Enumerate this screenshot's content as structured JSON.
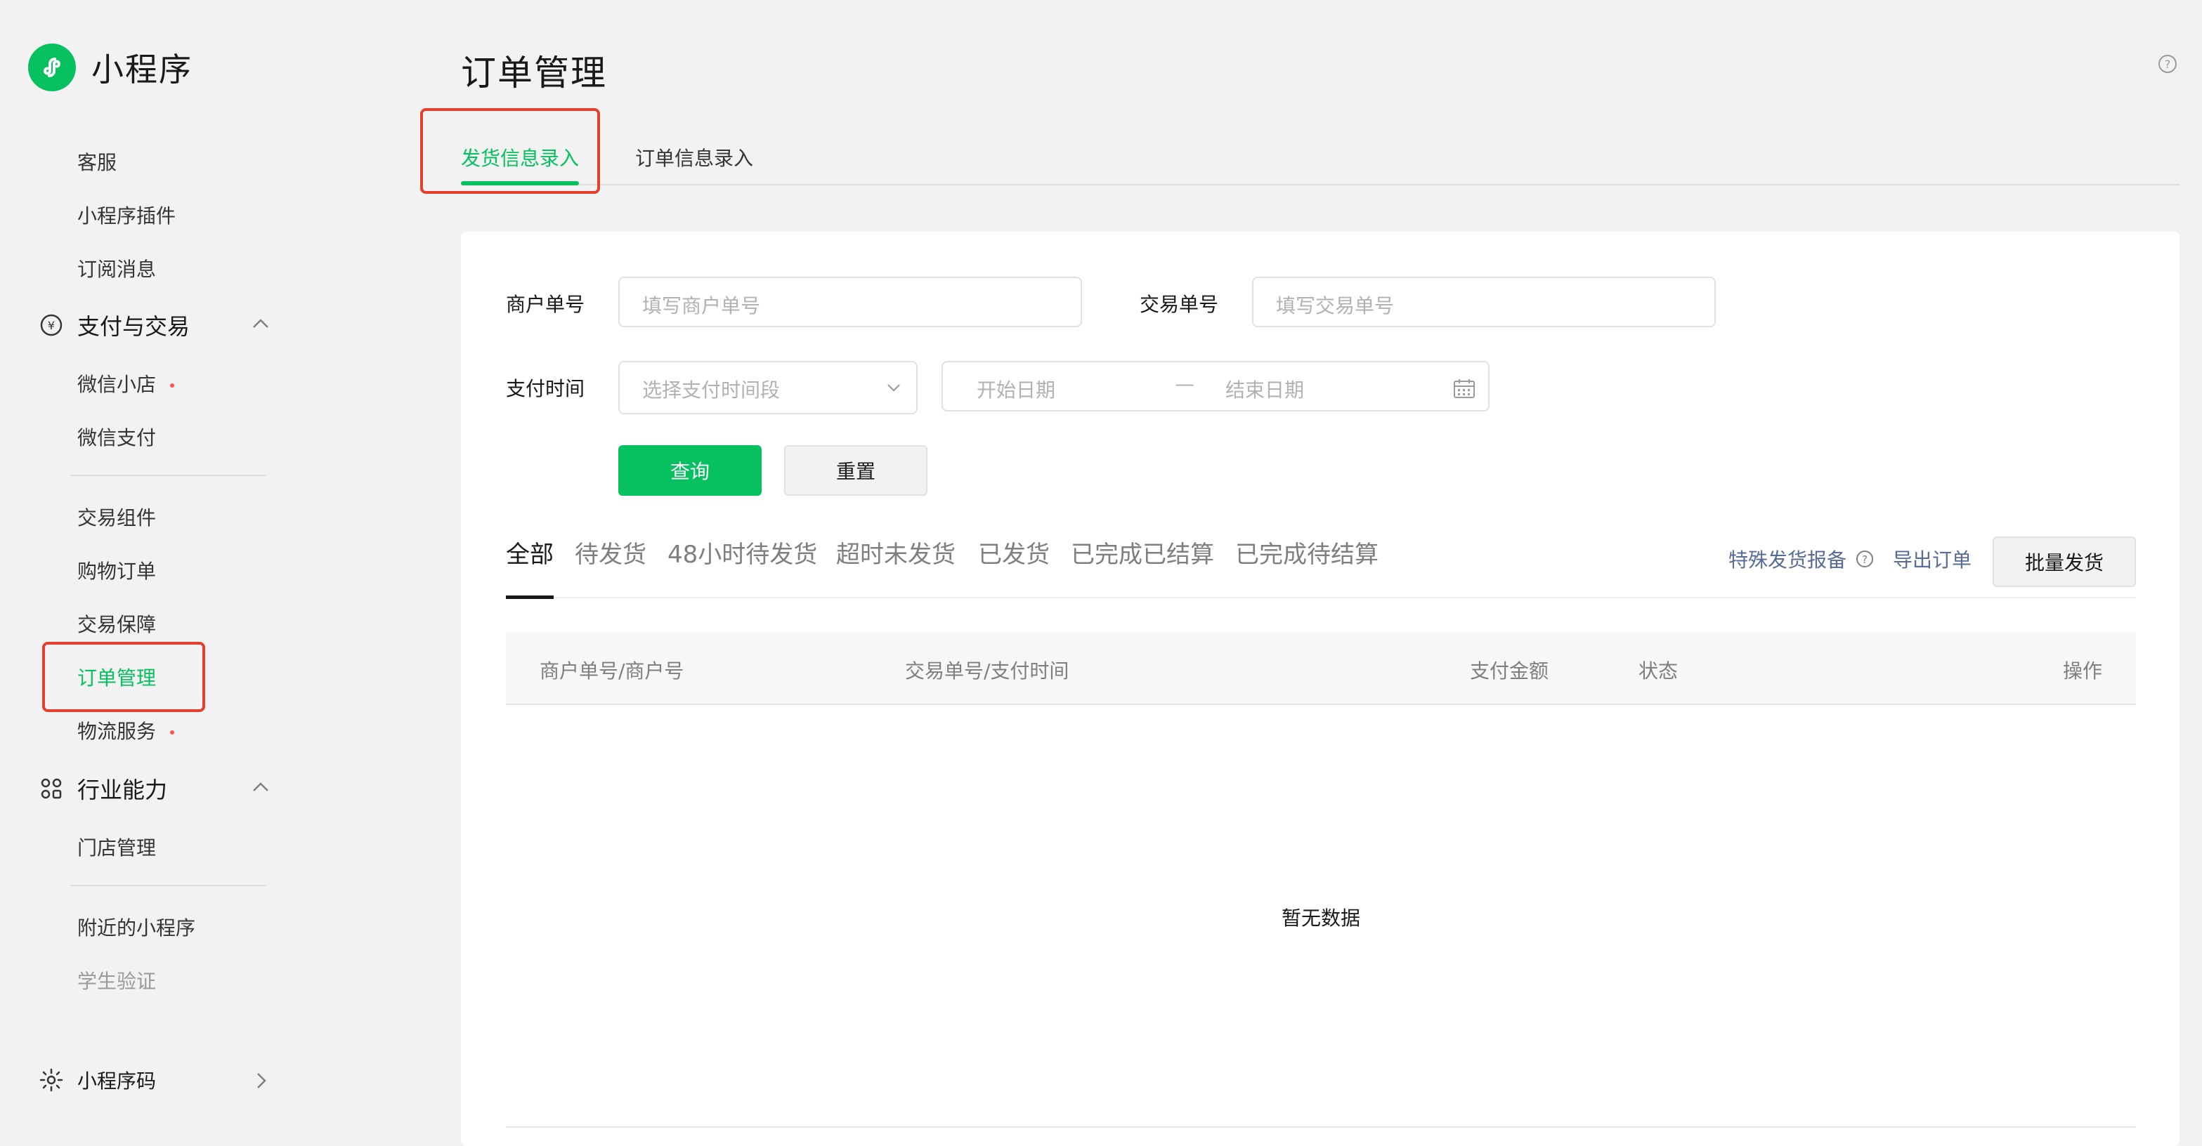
{
  "brand": {
    "name": "小程序"
  },
  "sidebar": {
    "items_top": [
      "客服",
      "小程序插件",
      "订阅消息"
    ],
    "group_payment": {
      "label": "支付与交易",
      "icon": "yen-circle-icon"
    },
    "payment_items": [
      {
        "label": "微信小店",
        "dot": true
      },
      {
        "label": "微信支付",
        "dot": false
      }
    ],
    "trade_items": [
      {
        "label": "交易组件"
      },
      {
        "label": "购物订单"
      },
      {
        "label": "交易保障"
      },
      {
        "label": "订单管理",
        "active": true
      },
      {
        "label": "物流服务",
        "dot": true
      }
    ],
    "group_industry": {
      "label": "行业能力",
      "icon": "industry-icon"
    },
    "industry_items": [
      "门店管理"
    ],
    "more_items": [
      {
        "label": "附近的小程序"
      },
      {
        "label": "学生验证"
      }
    ],
    "group_code": {
      "label": "小程序码",
      "icon": "sun-icon"
    }
  },
  "header": {
    "title": "订单管理"
  },
  "tabs": [
    {
      "label": "发货信息录入",
      "active": true
    },
    {
      "label": "订单信息录入",
      "active": false
    }
  ],
  "form": {
    "merchant_label": "商户单号",
    "merchant_placeholder": "填写商户单号",
    "trade_label": "交易单号",
    "trade_placeholder": "填写交易单号",
    "pay_time_label": "支付时间",
    "pay_time_placeholder": "选择支付时间段",
    "start_date_placeholder": "开始日期",
    "date_separator": "—",
    "end_date_placeholder": "结束日期",
    "query_button": "查询",
    "reset_button": "重置"
  },
  "filters": [
    "全部",
    "待发货",
    "48小时待发货",
    "超时未发货",
    "已发货",
    "已完成已结算",
    "已完成待结算"
  ],
  "actions": {
    "special_report": "特殊发货报备",
    "export": "导出订单",
    "batch_ship": "批量发货"
  },
  "table": {
    "columns": [
      "商户单号/商户号",
      "交易单号/支付时间",
      "支付金额",
      "状态",
      "操作"
    ],
    "empty_text": "暂无数据"
  },
  "colors": {
    "accent": "#07c160",
    "link": "#576b95",
    "highlight": "#e3412c"
  }
}
